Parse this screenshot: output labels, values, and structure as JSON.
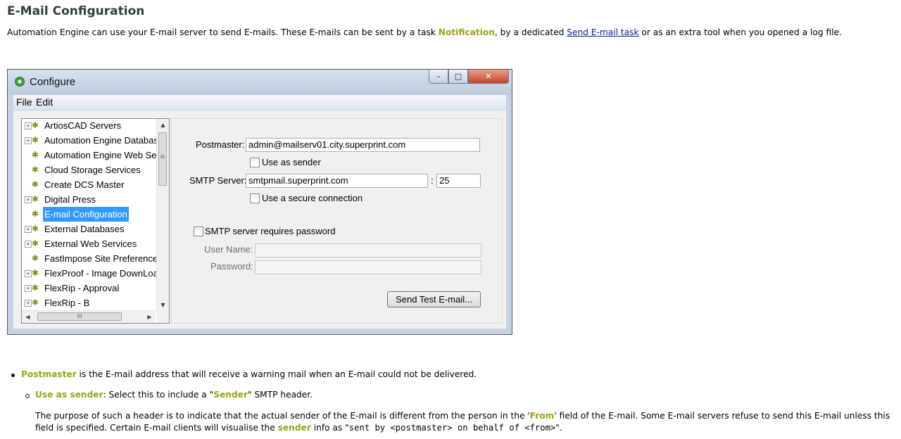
{
  "doc": {
    "title": "E-Mail Configuration",
    "intro_before": "Automation Engine can use your E-mail server to send E-mails. These E-mails can be sent by a task ",
    "intro_highlight": "Notification",
    "intro_mid": ", by a dedicated ",
    "intro_link": "Send E-mail task",
    "intro_after": " or as an extra tool when you opened a log file."
  },
  "window": {
    "title": "Configure",
    "buttons": {
      "minimize": "–",
      "maximize": "□",
      "close": "✕"
    },
    "menu": [
      "File",
      "Edit"
    ]
  },
  "tree": {
    "items": [
      {
        "label": "ArtiosCAD Servers",
        "expandable": true,
        "selected": false
      },
      {
        "label": "Automation Engine Databas",
        "expandable": true,
        "selected": false
      },
      {
        "label": "Automation Engine Web Se",
        "expandable": false,
        "selected": false
      },
      {
        "label": "Cloud Storage Services",
        "expandable": false,
        "selected": false
      },
      {
        "label": "Create DCS Master",
        "expandable": false,
        "selected": false
      },
      {
        "label": "Digital Press",
        "expandable": true,
        "selected": false
      },
      {
        "label": "E-mail Configuration",
        "expandable": false,
        "selected": true
      },
      {
        "label": "External Databases",
        "expandable": true,
        "selected": false
      },
      {
        "label": "External Web Services",
        "expandable": true,
        "selected": false
      },
      {
        "label": "FastImpose Site Preferences",
        "expandable": false,
        "selected": false
      },
      {
        "label": "FlexProof - Image DownLoad",
        "expandable": true,
        "selected": false
      },
      {
        "label": "FlexRip - Approval",
        "expandable": true,
        "selected": false
      },
      {
        "label": "FlexRip - B",
        "expandable": true,
        "selected": false
      }
    ],
    "expand_symbol": "+",
    "gear_symbol": "✱",
    "scroll_up": "▲",
    "scroll_down": "▼",
    "scroll_left": "◀",
    "scroll_right": "▶",
    "hthumb_grip": "III",
    "vthumb_grip": "≡"
  },
  "form": {
    "postmaster_label": "Postmaster:",
    "postmaster_value": "admin@mailserv01.city.superprint.com",
    "use_as_sender_label": "Use as sender",
    "smtp_label": "SMTP Server:",
    "smtp_value": "smtpmail.superprint.com",
    "port_sep": ":",
    "port_value": "25",
    "secure_label": "Use a secure connection",
    "requires_password_label": "SMTP server requires password",
    "username_label": "User Name:",
    "username_value": "",
    "password_label": "Password:",
    "password_value": "",
    "send_test_button": "Send Test E-mail..."
  },
  "bullets": {
    "b1_highlight": "Postmaster",
    "b1_text": " is the E-mail address that will receive a warning mail when an E-mail could not be delivered.",
    "b2_highlight": "Use as sender",
    "b2_text_a": ": Select this to include a \"",
    "b2_highlight2": "Sender",
    "b2_text_b": "\" SMTP header.",
    "p3_a": "The purpose of such a header is to indicate that the actual sender of the E-mail is different from the person in the '",
    "p3_from": "From",
    "p3_b": "' field of the E-mail. Some E-mail servers refuse to send this E-mail unless this field is specified. Certain E-mail clients will visualise the ",
    "p3_sender": "sender",
    "p3_c": " info as \"",
    "p3_mono": "sent by <postmaster> on behalf of <from>",
    "p3_d": "\"."
  }
}
